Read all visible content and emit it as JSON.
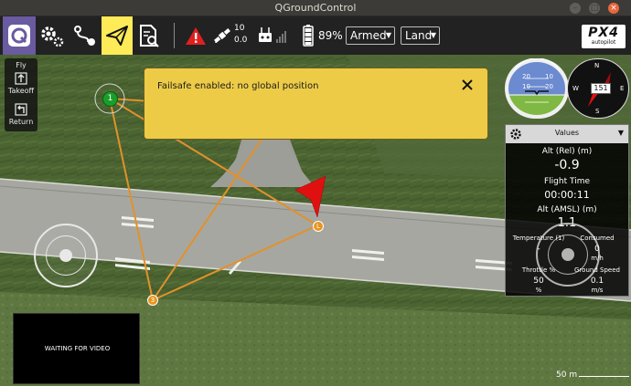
{
  "window": {
    "title": "QGroundControl"
  },
  "toolbar": {
    "gps": {
      "count": "10",
      "hdop": "0.0"
    },
    "battery": "89%",
    "flight_mode": "Armed",
    "vehicle_mode": "Land",
    "logo_brand": "PX4",
    "logo_sub": "autopilot"
  },
  "fly_panel": {
    "title": "Fly",
    "takeoff": "Takeoff",
    "return": "Return"
  },
  "map": {
    "waypoints": [
      {
        "label": "1"
      },
      {
        "label": "L"
      },
      {
        "label": "3"
      }
    ],
    "scale": "50 m"
  },
  "failsafe": {
    "message": "Failsafe enabled: no global position"
  },
  "compass": {
    "heading": "151",
    "n": "N",
    "e": "E",
    "s": "S",
    "w": "W"
  },
  "attitude": {
    "t1": "20",
    "t2": "10",
    "t3": "10",
    "t4": "20"
  },
  "values_panel": {
    "header": "Values",
    "alt_rel_label": "Alt (Rel) (m)",
    "alt_rel": "-0.9",
    "flight_time_label": "Flight Time",
    "flight_time": "00:00:11",
    "alt_amsl_label": "Alt (AMSL) (m)",
    "alt_amsl": "1.1",
    "temperature_label": "Temperature (1)",
    "temperature_value": "-",
    "consumed_label": "Consumed",
    "consumed_value": "0",
    "consumed_unit": "m/h",
    "throttle_label": "Throttle %",
    "throttle_value": "50",
    "throttle_unit": "%",
    "ground_speed_label": "Ground Speed",
    "ground_speed_value": "0.1",
    "ground_speed_unit": "m/s"
  },
  "video": {
    "status": "WAITING FOR VIDEO"
  },
  "colors": {
    "banner": "#edcb47",
    "accent": "#ffea58",
    "home_waypoint": "#1a9e2a",
    "waypoint": "#e8951c",
    "flight_path": "#e2912a",
    "vehicle": "#e01010",
    "alert": "#e02020"
  }
}
